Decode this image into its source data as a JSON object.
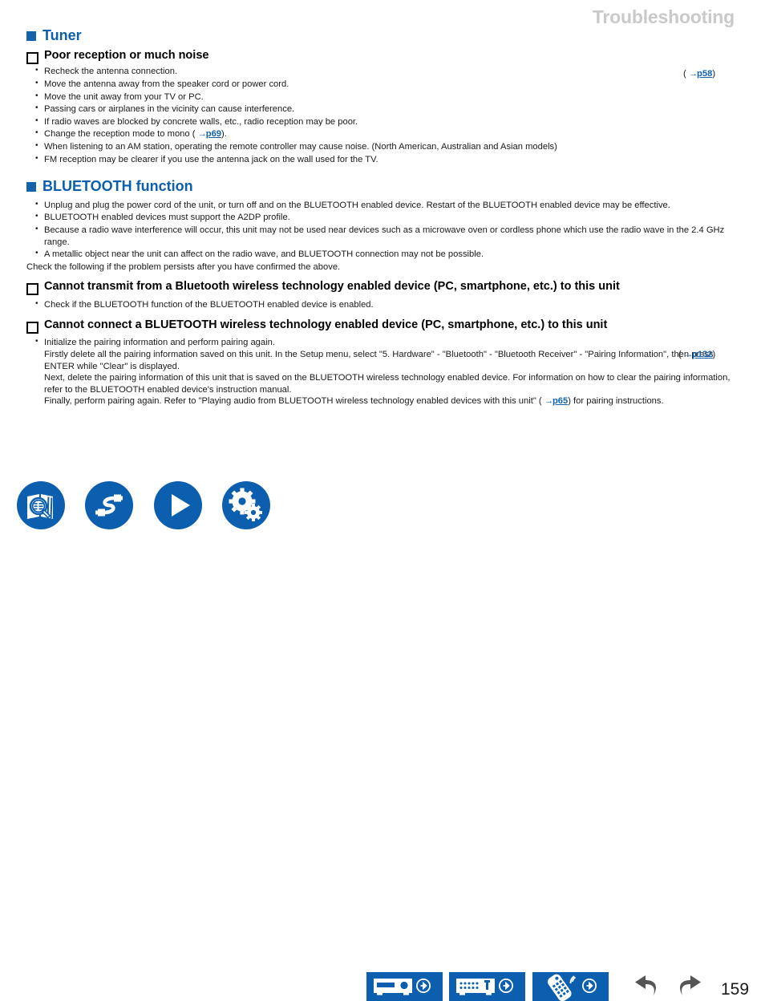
{
  "header": {
    "title": "Troubleshooting"
  },
  "sections": [
    {
      "id": "tuner",
      "title": "Tuner",
      "marker": "filled-square",
      "subheadings": [
        {
          "title": "Poor reception or much noise",
          "bullets": [
            "Recheck the antenna connection.",
            "Move the antenna away from the speaker cord or power cord.",
            "Move the unit away from your TV or PC.",
            "Passing cars or airplanes in the vicinity can cause interference.",
            "If radio waves are blocked by concrete walls, etc., radio reception may be poor.",
            "When listening to an AM station, operating the remote controller may cause noise. (North American, Australian and Asian models)",
            "FM reception may be clearer if you use the antenna jack on the wall used for the TV."
          ],
          "mono_bullet": {
            "before": "Change the reception mode to mono ( ",
            "arrow": "→",
            "link": "p69",
            "after": ")."
          }
        }
      ]
    },
    {
      "id": "bluetooth",
      "title": "BLUETOOTH function",
      "marker": "filled-square",
      "bullets": [
        "Unplug and plug the power cord of the unit, or turn off and on the BLUETOOTH enabled device. Restart of the BLUETOOTH enabled device may be effective.",
        "BLUETOOTH enabled devices must support the A2DP profile.",
        "Because a radio wave interference will occur, this unit may not be used near devices such as a microwave oven or cordless phone which use the radio wave in the 2.4 GHz range.",
        "A metallic object near the unit can affect on the radio wave, and BLUETOOTH connection may not be possible."
      ],
      "note": "Check the following if the problem persists after you have confirmed the above.",
      "subheadings": [
        {
          "title": "Cannot transmit from a Bluetooth wireless technology enabled device (PC, smartphone, etc.) to this unit",
          "bullets": [
            "Check if the BLUETOOTH function of the BLUETOOTH enabled device is enabled."
          ]
        },
        {
          "title": "Cannot connect a BLUETOOTH wireless technology enabled device (PC, smartphone, etc.) to this unit",
          "pairing": {
            "line1": "Initialize the pairing information and perform pairing again.",
            "line2": "Firstly delete all the pairing information saved on this unit. In the Setup menu, select \"5. Hardware\" - \"Bluetooth\" - \"Bluetooth Receiver\" - \"Pairing Information\", then press ENTER while \"Clear\" is displayed.",
            "line3": "Next, delete the pairing information of this unit that is saved on the BLUETOOTH wireless technology enabled device. For information on how to clear the pairing information, refer to the BLUETOOTH enabled device's instruction manual.",
            "line4_before": "Finally, perform pairing again. Refer to \"Playing audio from BLUETOOTH wireless technology enabled devices with this unit\" ( ",
            "line4_arrow": "→",
            "line4_link": "p65",
            "line4_after": ") for pairing instructions."
          }
        }
      ]
    }
  ],
  "page_refs": {
    "p58": {
      "open": "( ",
      "arrow": "→",
      "link": "p58",
      "close": ")"
    },
    "p132": {
      "open": "( ",
      "arrow": "→",
      "link": "p132",
      "close": ")"
    }
  },
  "footer": {
    "circle_buttons": [
      {
        "name": "contents",
        "icon": "book-search-icon",
        "label": "Contents"
      },
      {
        "name": "connections",
        "icon": "cable-icon",
        "label": "Connections"
      },
      {
        "name": "playback",
        "icon": "play-icon",
        "label": "Playback"
      },
      {
        "name": "setup",
        "icon": "gears-icon",
        "label": "Setup"
      }
    ],
    "panel_buttons": [
      {
        "name": "front-panel",
        "icon": "front-panel-icon",
        "label": "Front Panel"
      },
      {
        "name": "rear-panel",
        "icon": "rear-panel-icon",
        "label": "Rear Panel"
      },
      {
        "name": "remote-controller",
        "icon": "remote-icon",
        "label": "Remote Controller"
      }
    ],
    "nav": {
      "back": "back-arrow-icon",
      "forward": "forward-arrow-icon"
    },
    "page_number": "159"
  },
  "colors": {
    "accent_blue": "#0b5fae",
    "marker_blue": "#1462ac",
    "header_gray": "#c9c9c9",
    "nav_gray": "#555555",
    "text": "#1a1a1a"
  }
}
